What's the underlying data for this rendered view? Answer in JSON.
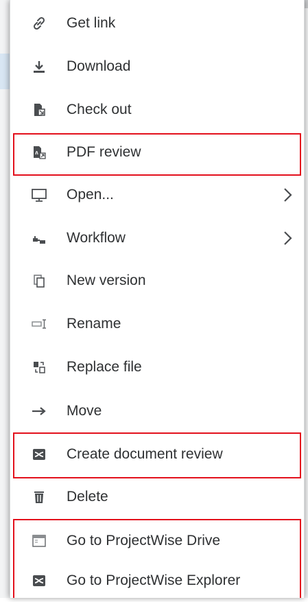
{
  "menu": {
    "items": [
      {
        "label": "Get link",
        "icon": "link-icon",
        "has_submenu": false
      },
      {
        "label": "Download",
        "icon": "download-icon",
        "has_submenu": false
      },
      {
        "label": "Check out",
        "icon": "check-out-icon",
        "has_submenu": false
      },
      {
        "label": "PDF review",
        "icon": "pdf-review-icon",
        "has_submenu": false
      },
      {
        "label": "Open...",
        "icon": "monitor-icon",
        "has_submenu": true
      },
      {
        "label": "Workflow",
        "icon": "workflow-icon",
        "has_submenu": true
      },
      {
        "label": "New version",
        "icon": "new-version-icon",
        "has_submenu": false
      },
      {
        "label": "Rename",
        "icon": "rename-icon",
        "has_submenu": false
      },
      {
        "label": "Replace file",
        "icon": "replace-file-icon",
        "has_submenu": false
      },
      {
        "label": "Move",
        "icon": "arrow-right-icon",
        "has_submenu": false
      },
      {
        "label": "Create document review",
        "icon": "document-review-icon",
        "has_submenu": false
      },
      {
        "label": "Delete",
        "icon": "trash-icon",
        "has_submenu": false
      },
      {
        "label": "Go to ProjectWise Drive",
        "icon": "projectwise-drive-icon",
        "has_submenu": false
      },
      {
        "label": "Go to ProjectWise Explorer",
        "icon": "projectwise-explorer-icon",
        "has_submenu": false
      }
    ]
  },
  "colors": {
    "text": "#2f3133",
    "icon": "#4a4d50",
    "highlight": "#e3101c",
    "background": "#f3f4f5"
  }
}
